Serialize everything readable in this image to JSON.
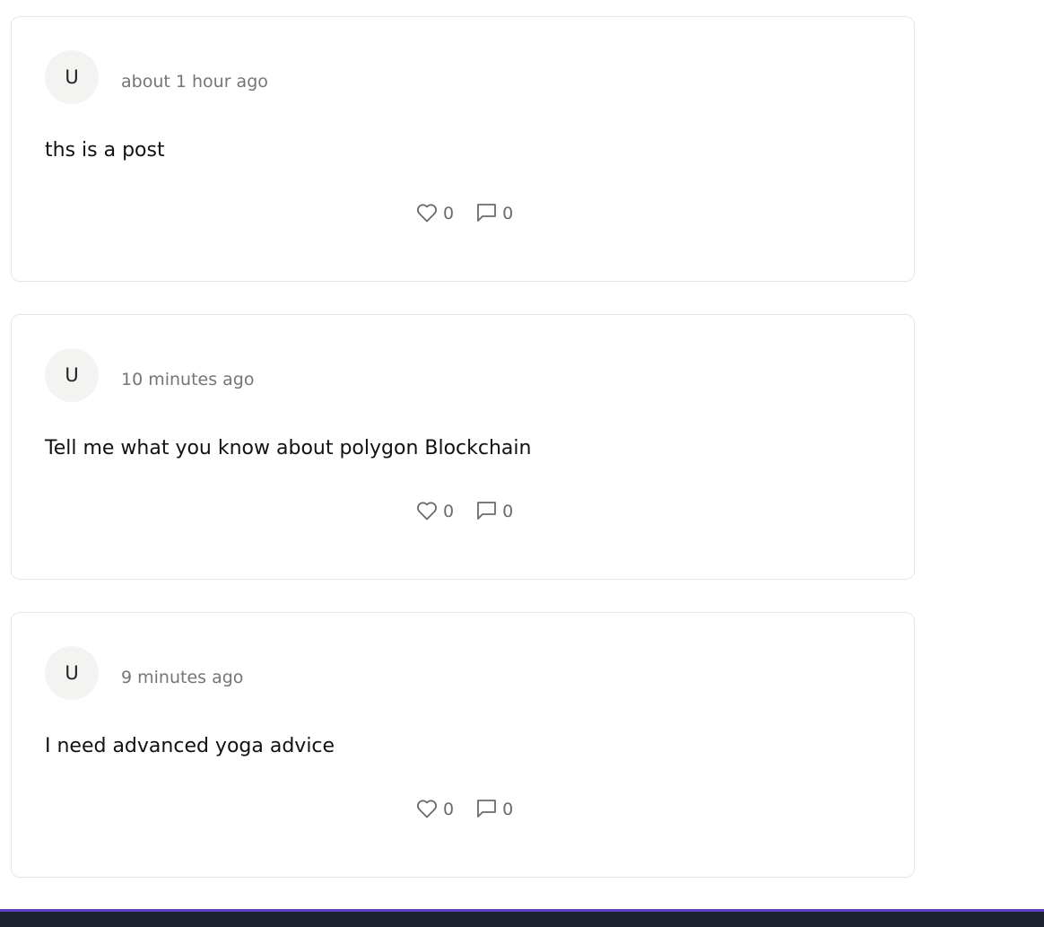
{
  "posts": [
    {
      "avatar_initial": "U",
      "timestamp": "about 1 hour ago",
      "content": "ths is a post",
      "likes": "0",
      "comments": "0"
    },
    {
      "avatar_initial": "U",
      "timestamp": "10 minutes ago",
      "content": "Tell me what you know about polygon Blockchain",
      "likes": "0",
      "comments": "0"
    },
    {
      "avatar_initial": "U",
      "timestamp": "9 minutes ago",
      "content": "I need advanced yoga advice",
      "likes": "0",
      "comments": "0"
    }
  ],
  "icons": {
    "like": "heart-icon",
    "comment": "comment-icon"
  },
  "colors": {
    "card_border": "#e5e5e5",
    "avatar_bg": "#f3f3f1",
    "muted_text": "#757575",
    "bottom_bar": "#1c2130",
    "bottom_bar_accent": "#5b3fc4"
  }
}
